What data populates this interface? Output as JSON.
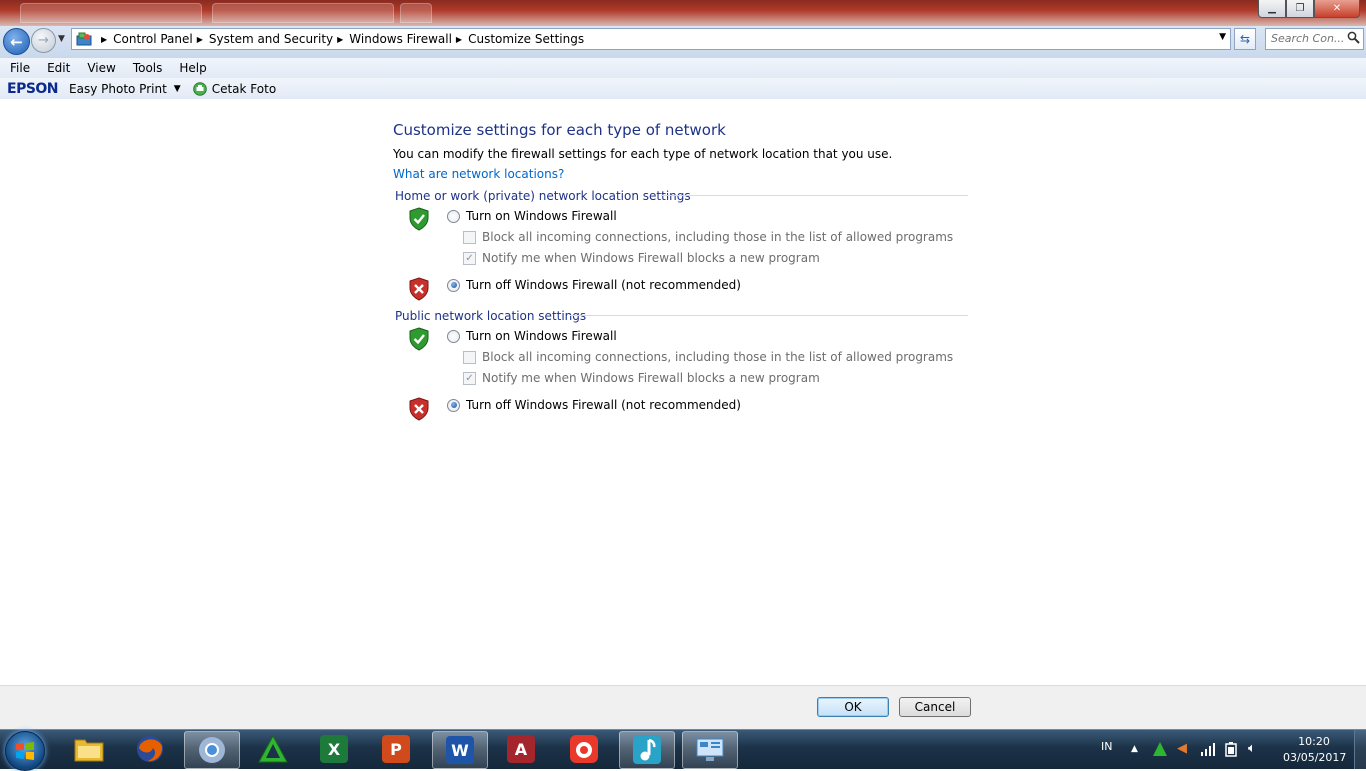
{
  "address_bar": {
    "breadcrumbs": [
      "Control Panel",
      "System and Security",
      "Windows Firewall",
      "Customize Settings"
    ],
    "search_placeholder": "Search Con..."
  },
  "menu": {
    "items": [
      "File",
      "Edit",
      "View",
      "Tools",
      "Help"
    ]
  },
  "toolbar": {
    "brand": "EPSON",
    "easy_photo_print": "Easy Photo Print",
    "cetak_foto": "Cetak Foto"
  },
  "page": {
    "title": "Customize settings for each type of network",
    "intro": "You can modify the firewall settings for each type of network location that you use.",
    "help_link": "What are network locations?"
  },
  "sections": [
    {
      "heading": "Home or work (private) network location settings",
      "turn_on_label": "Turn on Windows Firewall",
      "turn_on_selected": false,
      "block_label": "Block all incoming connections, including those in the list of allowed programs",
      "block_checked": false,
      "notify_label": "Notify me when Windows Firewall blocks a new program",
      "notify_checked": true,
      "turn_off_label": "Turn off Windows Firewall (not recommended)",
      "turn_off_selected": true
    },
    {
      "heading": "Public network location settings",
      "turn_on_label": "Turn on Windows Firewall",
      "turn_on_selected": false,
      "block_label": "Block all incoming connections, including those in the list of allowed programs",
      "block_checked": false,
      "notify_label": "Notify me when Windows Firewall blocks a new program",
      "notify_checked": true,
      "turn_off_label": "Turn off Windows Firewall (not recommended)",
      "turn_off_selected": true
    }
  ],
  "buttons": {
    "ok": "OK",
    "cancel": "Cancel"
  },
  "taskbar": {
    "apps": [
      {
        "name": "windows-explorer",
        "icon": "folder-icon",
        "color": "#e8b830"
      },
      {
        "name": "firefox",
        "icon": "firefox-icon",
        "color": "#e66000"
      },
      {
        "name": "chrome",
        "icon": "chrome-icon",
        "color": "#4a90d9"
      },
      {
        "name": "green-triangle-app",
        "icon": "triangle-icon",
        "color": "#2fb52f"
      },
      {
        "name": "excel",
        "icon": "excel-icon",
        "color": "#1d7a3a"
      },
      {
        "name": "powerpoint",
        "icon": "powerpoint-icon",
        "color": "#d04a1c"
      },
      {
        "name": "word",
        "icon": "word-icon",
        "color": "#1f55a8"
      },
      {
        "name": "access",
        "icon": "access-icon",
        "color": "#a4262c"
      },
      {
        "name": "camera-app",
        "icon": "camera-icon",
        "color": "#e8392b"
      },
      {
        "name": "music-app",
        "icon": "music-icon",
        "color": "#2aa3c8"
      },
      {
        "name": "control-panel",
        "icon": "control-panel-icon",
        "color": "#3c86c8"
      }
    ],
    "language": "IN",
    "time": "10:20",
    "date": "03/05/2017"
  },
  "colors": {
    "heading_blue": "#1e3287",
    "link_blue": "#0066cc",
    "shield_green": "#2f9a2f",
    "shield_red": "#c8302c"
  }
}
